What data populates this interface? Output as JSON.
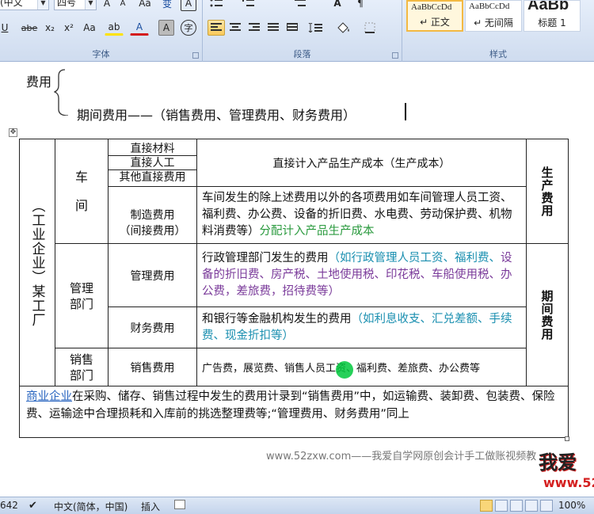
{
  "ribbon": {
    "font_group": {
      "font_name": "(中文",
      "font_size": "四号",
      "label": "字体",
      "buttons": [
        "A",
        "A",
        "Aa",
        "变",
        "A",
        "U",
        "abe",
        "x₂",
        "x²",
        "Aa",
        "ab",
        "A",
        "A",
        "字"
      ]
    },
    "paragraph_group": {
      "label": "段落"
    },
    "styles_group": {
      "label": "样式",
      "styles": [
        {
          "sample": "AaBbCcDd",
          "name": "↵ 正文"
        },
        {
          "sample": "AaBbCcDd",
          "name": "↵ 无间隔"
        },
        {
          "sample": "AaBb",
          "name": "标题 1"
        }
      ]
    }
  },
  "document": {
    "line_fee": "费用",
    "line_period": "期间费用——（销售费用、管理费用、财务费用）",
    "table": {
      "enterprise": "（工业企业）某工厂",
      "workshop_1": "车",
      "workshop_2": "间",
      "direct_items": [
        "直接材料",
        "直接人工",
        "其他直接费用"
      ],
      "direct_desc": "直接计入产品生产成本（生产成本）",
      "production_cost": "生产费用",
      "mfg_name": "制造费用\n（间接费用）",
      "mfg_desc_main": "车间发生的除上述费用以外的各项费用如车间管理人员工资、福利费、办公费、设备的折旧费、水电费、劳动保护费、机物料消费等）",
      "mfg_desc_tail": "分配计入产品生产成本",
      "mgmt_dept": "管理部门",
      "mgmt_fee": "管理费用",
      "mgmt_desc_main": "行政管理部门发生的费用",
      "mgmt_desc_part1": "（如行政管理人员工资、福利费、",
      "mgmt_desc_part2": "设备的折旧费、房产税、土地使用税、印花税、车船使用税、办公费，差旅费，招待费等）",
      "period_cost": "期间费用",
      "fin_fee": "财务费用",
      "fin_desc_main": "和银行等金融机构发生的费用",
      "fin_desc_detail": "（如利息收支、汇兑差额、手续费、现金折扣等）",
      "sales_dept": "销售部门",
      "sales_fee": "销售费用",
      "sales_desc": "广告费，展览费、销售人员工资、福利费、差旅费、办公费等",
      "commerce_lead": "商业企业",
      "commerce_desc": "在采购、储存、销售过程中发生的费用计录到“销售费用”中，如运输费、装卸费、包装费、保险费、运输途中合理损耗和入库前的挑选整理费等;“管理费用、财务费用”同上"
    },
    "watermark": "www.52zxw.com——我爱自学网原创会计手工做账视频教",
    "logo_text": "我爱",
    "logo_url": "www.52"
  },
  "status_bar": {
    "page_count": "642",
    "language": "中文(简体，中国)",
    "insert_mode": "插入",
    "zoom": "100%"
  }
}
